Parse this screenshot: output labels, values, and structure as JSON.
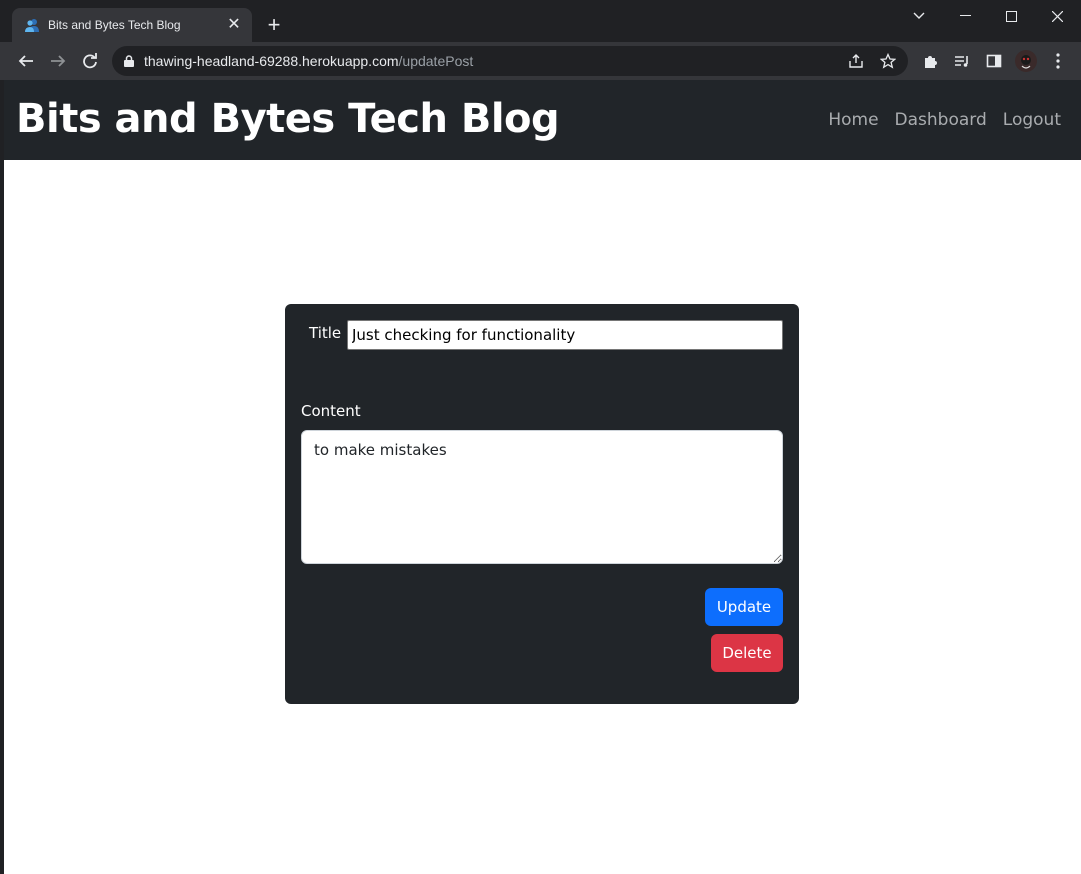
{
  "browser": {
    "tab": {
      "title": "Bits and Bytes Tech Blog",
      "close_icon": "close-icon"
    },
    "url": {
      "host": "thawing-headland-69288.herokuapp.com",
      "path": "/updatePost"
    }
  },
  "navbar": {
    "brand": "Bits and Bytes Tech Blog",
    "links": [
      {
        "label": "Home"
      },
      {
        "label": "Dashboard"
      },
      {
        "label": "Logout"
      }
    ]
  },
  "form": {
    "title_label": "Title",
    "title_value": "Just checking for functionality",
    "content_label": "Content",
    "content_value": "to make mistakes",
    "update_label": "Update",
    "delete_label": "Delete"
  },
  "colors": {
    "navbar": "#212529",
    "update_button": "#0d6efd",
    "delete_button": "#dc3545"
  }
}
